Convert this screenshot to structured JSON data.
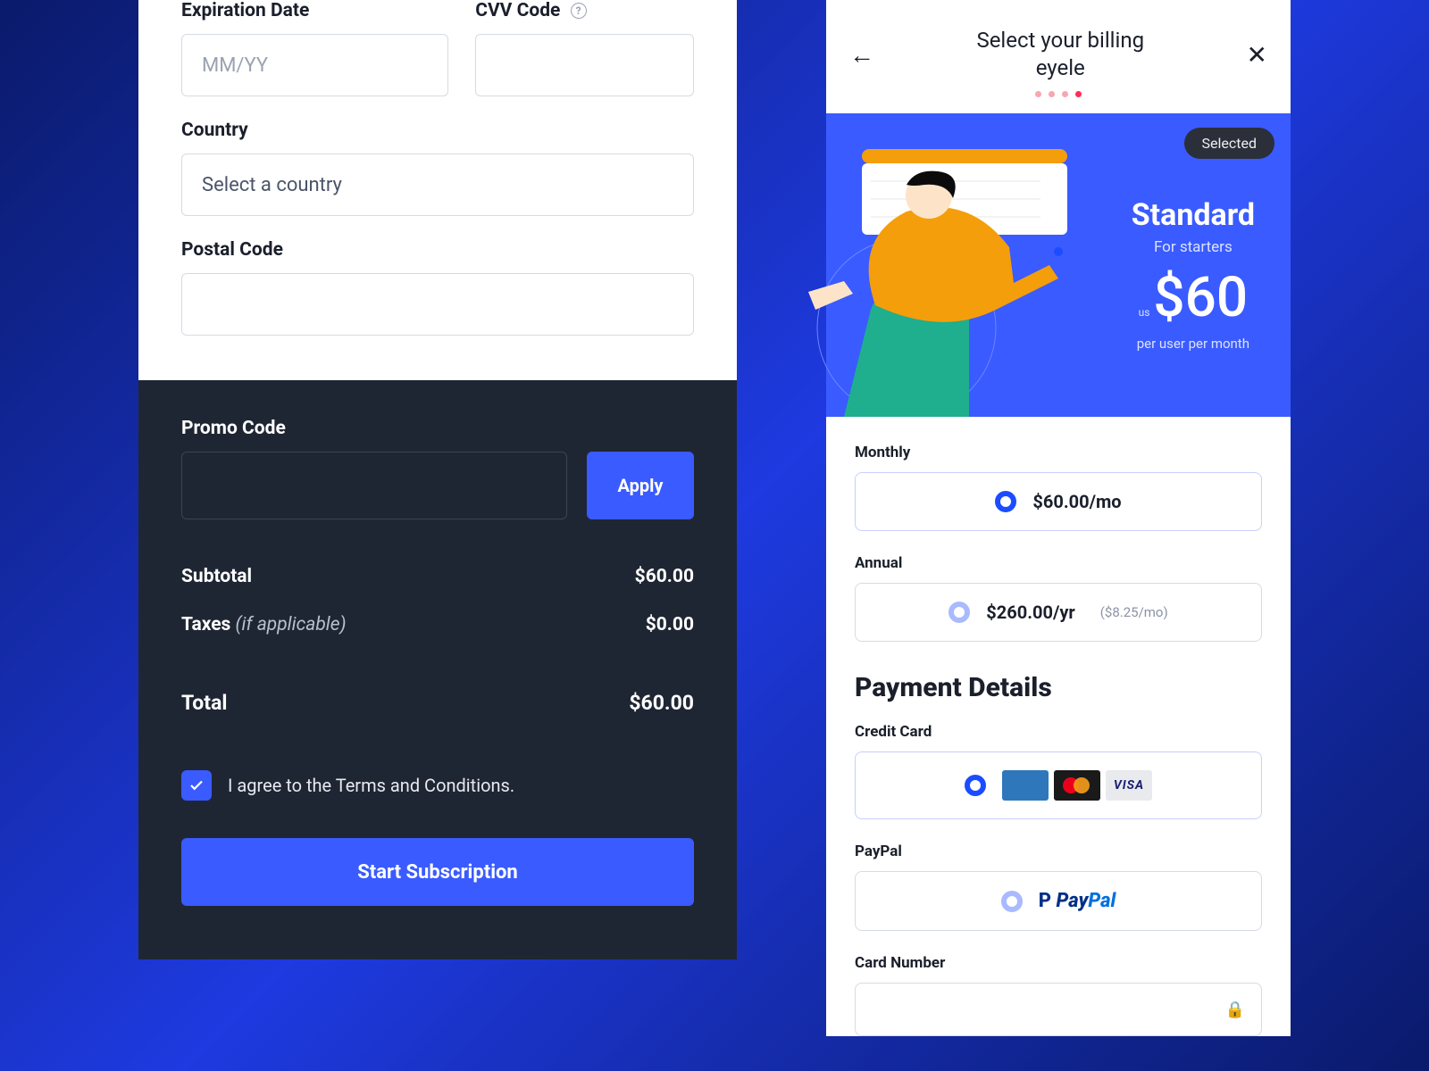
{
  "left": {
    "expiration_label": "Expiration Date",
    "expiration_placeholder": "MM/YY",
    "cvv_label": "CVV Code",
    "country_label": "Country",
    "country_placeholder": "Select a country",
    "postal_label": "Postal Code",
    "promo_label": "Promo Code",
    "apply_label": "Apply",
    "subtotal_label": "Subtotal",
    "subtotal_value": "$60.00",
    "taxes_label": "Taxes",
    "taxes_note": "(if applicable)",
    "taxes_value": "$0.00",
    "total_label": "Total",
    "total_value": "$60.00",
    "agree_text": "I agree to the Terms and Conditions.",
    "start_label": "Start Subscription"
  },
  "right": {
    "title_line1": "Select your billing",
    "title_line2": "eyele",
    "selected_badge": "Selected",
    "plan": {
      "name": "Standard",
      "subtitle": "For starters",
      "currency_prefix": "us",
      "price": "$60",
      "per": "per user per month"
    },
    "monthly_label": "Monthly",
    "monthly_price": "$60.00/mo",
    "annual_label": "Annual",
    "annual_price": "$260.00/yr",
    "annual_sub": "($8.25/mo)",
    "payment_heading": "Payment Details",
    "cc_label": "Credit Card",
    "paypal_label": "PayPal",
    "visa_text": "VISA",
    "paypal_text_1": "Pay",
    "paypal_text_2": "Pal",
    "card_number_label": "Card Number"
  }
}
